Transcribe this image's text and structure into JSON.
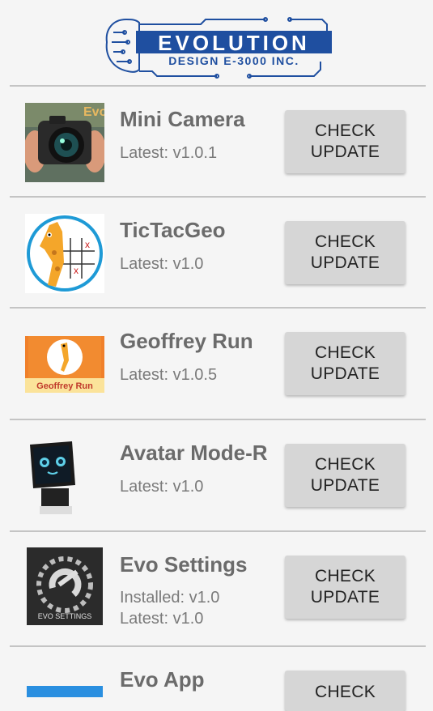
{
  "header": {
    "logo_line1": "EVOLUTION",
    "logo_line2": "DESIGN E-3000 INC."
  },
  "apps": [
    {
      "name": "Mini Camera",
      "installed": "",
      "latest": "Latest: v1.0.1",
      "button": "CHECK\nUPDATE",
      "icon": "camera-icon"
    },
    {
      "name": "TicTacGeo",
      "installed": "",
      "latest": "Latest: v1.0",
      "button": "CHECK\nUPDATE",
      "icon": "giraffe-tictactoe-icon"
    },
    {
      "name": "Geoffrey Run",
      "installed": "",
      "latest": "Latest: v1.0.5",
      "button": "CHECK\nUPDATE",
      "icon": "geoffrey-run-icon",
      "icon_caption": "Geoffrey Run"
    },
    {
      "name": "Avatar Mode-R",
      "installed": "",
      "latest": "Latest: v1.0",
      "button": "CHECK\nUPDATE",
      "icon": "robot-avatar-icon"
    },
    {
      "name": "Evo Settings",
      "installed": "Installed: v1.0",
      "latest": "Latest: v1.0",
      "button": "CHECK\nUPDATE",
      "icon": "evo-settings-icon",
      "icon_caption": "EVO SETTINGS"
    },
    {
      "name": "Evo App",
      "installed": "",
      "latest": "",
      "button": "CHECK",
      "icon": "evo-app-icon"
    }
  ],
  "colors": {
    "background": "#f5f5f5",
    "button": "#d6d6d6",
    "logo_blue": "#1f4fa0",
    "title_gray": "#6b6b6b"
  }
}
